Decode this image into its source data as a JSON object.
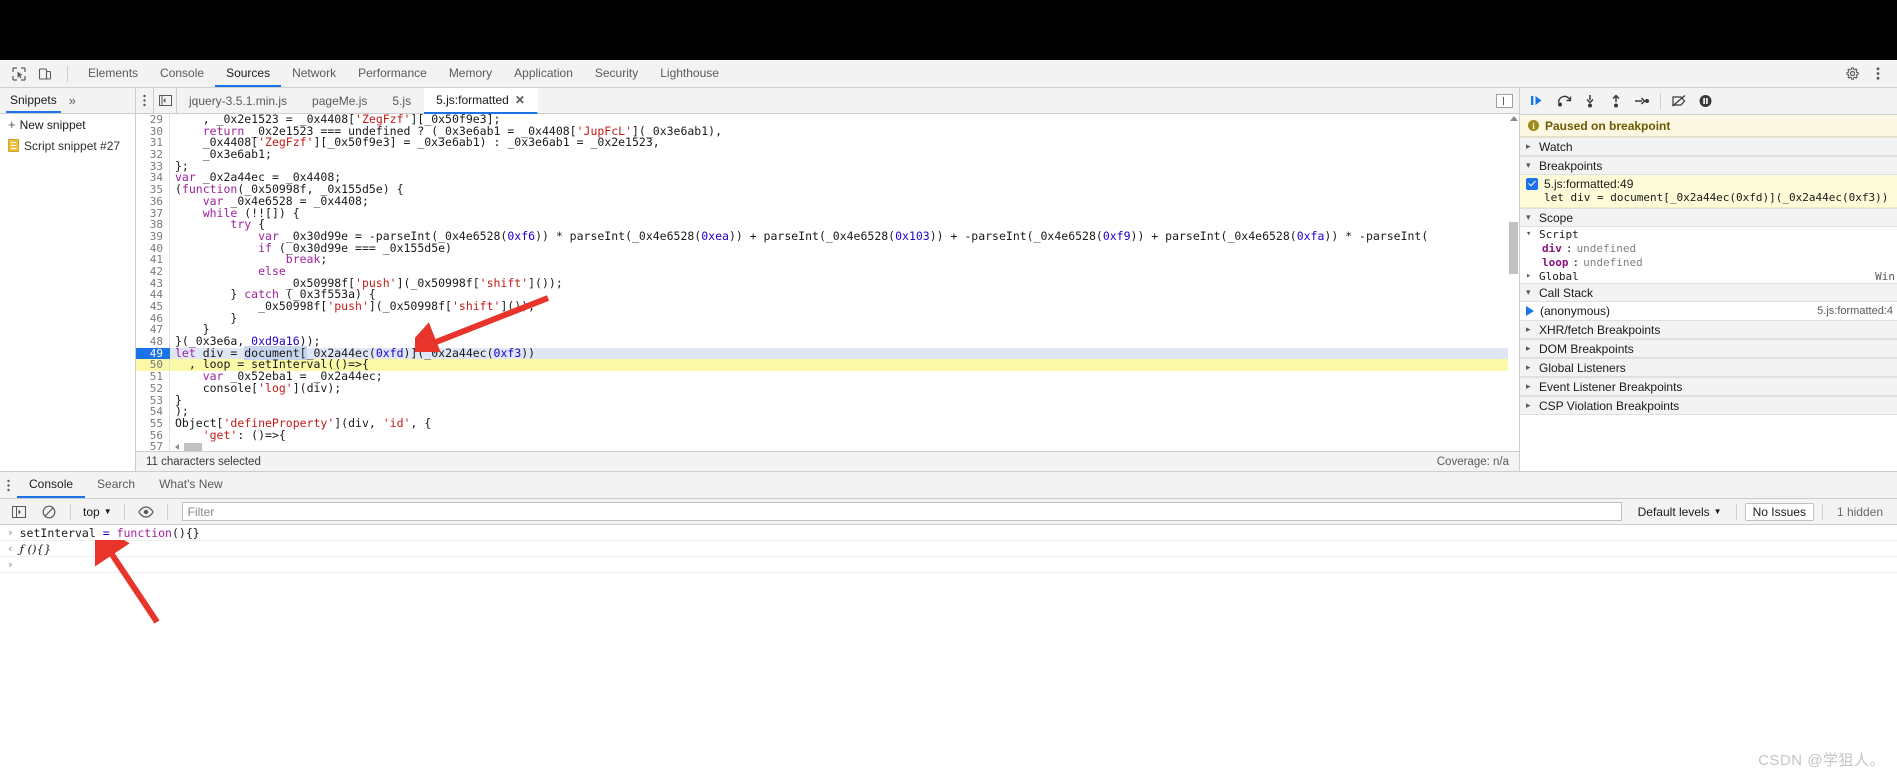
{
  "toolbar": {
    "icons": [
      {
        "name": "inspect-element-icon",
        "label": "Inspect element"
      },
      {
        "name": "device-toolbar-icon",
        "label": "Toggle device toolbar"
      }
    ],
    "tabs": [
      {
        "label": "Elements",
        "active": false
      },
      {
        "label": "Console",
        "active": false
      },
      {
        "label": "Sources",
        "active": true
      },
      {
        "label": "Network",
        "active": false
      },
      {
        "label": "Performance",
        "active": false
      },
      {
        "label": "Memory",
        "active": false
      },
      {
        "label": "Application",
        "active": false
      },
      {
        "label": "Security",
        "active": false
      },
      {
        "label": "Lighthouse",
        "active": false
      }
    ],
    "right_icons": [
      {
        "name": "settings-gear-icon",
        "label": "Settings"
      },
      {
        "name": "more-options-icon",
        "label": "Customize and control DevTools"
      }
    ]
  },
  "navigator": {
    "tab_label": "Snippets",
    "more_label": "»",
    "new_snippet_label": "New snippet",
    "items": [
      {
        "label": "Script snippet #27"
      }
    ]
  },
  "editor": {
    "tabs": [
      {
        "label": "jquery-3.5.1.min.js",
        "active": false,
        "closeable": false
      },
      {
        "label": "pageMe.js",
        "active": false,
        "closeable": false
      },
      {
        "label": "5.js",
        "active": false,
        "closeable": false
      },
      {
        "label": "5.js:formatted",
        "active": true,
        "closeable": true,
        "close_label": "✕"
      }
    ],
    "status": {
      "selection": "11 characters selected",
      "coverage": "Coverage: n/a"
    },
    "first_line_number": 29,
    "lines": [
      {
        "n": 29,
        "tokens": [
          {
            "t": "    , ",
            "c": "t-plain"
          },
          {
            "t": "_0x2e1523 ",
            "c": "t-plain"
          },
          {
            "t": "= ",
            "c": "t-plain"
          },
          {
            "t": "_0x4408[",
            "c": "t-plain"
          },
          {
            "t": "'ZegFzf'",
            "c": "t-str"
          },
          {
            "t": "][_0x50f9e3];",
            "c": "t-plain"
          }
        ],
        "state": "clipped"
      },
      {
        "n": 30,
        "tokens": [
          {
            "t": "    ",
            "c": "t-plain"
          },
          {
            "t": "return ",
            "c": "t-key"
          },
          {
            "t": "_0x2e1523 === ",
            "c": "t-plain"
          },
          {
            "t": "undefined ",
            "c": "t-plain"
          },
          {
            "t": "? (_0x3e6ab1 = _0x4408[",
            "c": "t-plain"
          },
          {
            "t": "'JupFcL'",
            "c": "t-str"
          },
          {
            "t": "](_0x3e6ab1),",
            "c": "t-plain"
          }
        ],
        "state": "normal"
      },
      {
        "n": 31,
        "tokens": [
          {
            "t": "    _0x4408[",
            "c": "t-plain"
          },
          {
            "t": "'ZegFzf'",
            "c": "t-str"
          },
          {
            "t": "][_0x50f9e3] = _0x3e6ab1) : _0x3e6ab1 = _0x2e1523,",
            "c": "t-plain"
          }
        ],
        "state": "normal"
      },
      {
        "n": 32,
        "tokens": [
          {
            "t": "    _0x3e6ab1;",
            "c": "t-plain"
          }
        ],
        "state": "normal"
      },
      {
        "n": 33,
        "tokens": [
          {
            "t": "};",
            "c": "t-plain"
          }
        ],
        "state": "normal"
      },
      {
        "n": 34,
        "tokens": [
          {
            "t": "var ",
            "c": "t-key"
          },
          {
            "t": "_0x2a44ec = _0x4408;",
            "c": "t-plain"
          }
        ],
        "state": "normal"
      },
      {
        "n": 35,
        "tokens": [
          {
            "t": "(",
            "c": "t-plain"
          },
          {
            "t": "function",
            "c": "t-key"
          },
          {
            "t": "(_0x50998f, _0x155d5e) {",
            "c": "t-plain"
          }
        ],
        "state": "normal"
      },
      {
        "n": 36,
        "tokens": [
          {
            "t": "    ",
            "c": "t-plain"
          },
          {
            "t": "var ",
            "c": "t-key"
          },
          {
            "t": "_0x4e6528 = _0x4408;",
            "c": "t-plain"
          }
        ],
        "state": "normal"
      },
      {
        "n": 37,
        "tokens": [
          {
            "t": "    ",
            "c": "t-plain"
          },
          {
            "t": "while ",
            "c": "t-key"
          },
          {
            "t": "(!![]) {",
            "c": "t-plain"
          }
        ],
        "state": "normal"
      },
      {
        "n": 38,
        "tokens": [
          {
            "t": "        ",
            "c": "t-plain"
          },
          {
            "t": "try ",
            "c": "t-key"
          },
          {
            "t": "{",
            "c": "t-plain"
          }
        ],
        "state": "normal"
      },
      {
        "n": 39,
        "tokens": [
          {
            "t": "            ",
            "c": "t-plain"
          },
          {
            "t": "var ",
            "c": "t-key"
          },
          {
            "t": "_0x30d99e = -parseInt(_0x4e6528(",
            "c": "t-plain"
          },
          {
            "t": "0xf6",
            "c": "t-num"
          },
          {
            "t": ")) * parseInt(_0x4e6528(",
            "c": "t-plain"
          },
          {
            "t": "0xea",
            "c": "t-num"
          },
          {
            "t": ")) + parseInt(_0x4e6528(",
            "c": "t-plain"
          },
          {
            "t": "0x103",
            "c": "t-num"
          },
          {
            "t": ")) + -parseInt(_0x4e6528(",
            "c": "t-plain"
          },
          {
            "t": "0xf9",
            "c": "t-num"
          },
          {
            "t": ")) + parseInt(_0x4e6528(",
            "c": "t-plain"
          },
          {
            "t": "0xfa",
            "c": "t-num"
          },
          {
            "t": ")) * -parseInt(",
            "c": "t-plain"
          }
        ],
        "state": "normal"
      },
      {
        "n": 40,
        "tokens": [
          {
            "t": "            ",
            "c": "t-plain"
          },
          {
            "t": "if ",
            "c": "t-key"
          },
          {
            "t": "(_0x30d99e === _0x155d5e)",
            "c": "t-plain"
          }
        ],
        "state": "normal"
      },
      {
        "n": 41,
        "tokens": [
          {
            "t": "                ",
            "c": "t-plain"
          },
          {
            "t": "break",
            "c": "t-key"
          },
          {
            "t": ";",
            "c": "t-plain"
          }
        ],
        "state": "normal"
      },
      {
        "n": 42,
        "tokens": [
          {
            "t": "            ",
            "c": "t-plain"
          },
          {
            "t": "else",
            "c": "t-key"
          }
        ],
        "state": "normal"
      },
      {
        "n": 43,
        "tokens": [
          {
            "t": "                _0x50998f[",
            "c": "t-plain"
          },
          {
            "t": "'push'",
            "c": "t-str"
          },
          {
            "t": "](_0x50998f[",
            "c": "t-plain"
          },
          {
            "t": "'shift'",
            "c": "t-str"
          },
          {
            "t": "]());",
            "c": "t-plain"
          }
        ],
        "state": "normal"
      },
      {
        "n": 44,
        "tokens": [
          {
            "t": "        } ",
            "c": "t-plain"
          },
          {
            "t": "catch ",
            "c": "t-key"
          },
          {
            "t": "(_0x3f553a) {",
            "c": "t-plain"
          }
        ],
        "state": "normal"
      },
      {
        "n": 45,
        "tokens": [
          {
            "t": "            _0x50998f[",
            "c": "t-plain"
          },
          {
            "t": "'push'",
            "c": "t-str"
          },
          {
            "t": "](_0x50998f[",
            "c": "t-plain"
          },
          {
            "t": "'shift'",
            "c": "t-str"
          },
          {
            "t": "]());",
            "c": "t-plain"
          }
        ],
        "state": "normal"
      },
      {
        "n": 46,
        "tokens": [
          {
            "t": "        }",
            "c": "t-plain"
          }
        ],
        "state": "normal"
      },
      {
        "n": 47,
        "tokens": [
          {
            "t": "    }",
            "c": "t-plain"
          }
        ],
        "state": "normal"
      },
      {
        "n": 48,
        "tokens": [
          {
            "t": "}(_0x3e6a, ",
            "c": "t-plain"
          },
          {
            "t": "0xd9a16",
            "c": "t-num"
          },
          {
            "t": "));",
            "c": "t-plain"
          }
        ],
        "state": "normal"
      },
      {
        "n": 49,
        "tokens": [
          {
            "t": "let ",
            "c": "t-key"
          },
          {
            "t": "div = ",
            "c": "t-plain"
          },
          {
            "t": "document[",
            "c": "sel"
          },
          {
            "t": "_0x2a44ec(",
            "c": "t-plain"
          },
          {
            "t": "0xfd",
            "c": "t-num"
          },
          {
            "t": ")](",
            "c": "t-plain"
          },
          {
            "t": "_0x2a44ec(",
            "c": "t-plain"
          },
          {
            "t": "0xf3",
            "c": "t-num"
          },
          {
            "t": "))",
            "c": "t-plain"
          }
        ],
        "state": "exec"
      },
      {
        "n": 50,
        "tokens": [
          {
            "t": "  , loop = ",
            "c": "t-plain"
          },
          {
            "t": "setInterval",
            "c": "t-plain"
          },
          {
            "t": "(()=>{",
            "c": "t-plain"
          }
        ],
        "state": "hl"
      },
      {
        "n": 51,
        "tokens": [
          {
            "t": "    ",
            "c": "t-plain"
          },
          {
            "t": "var ",
            "c": "t-key"
          },
          {
            "t": "_0x52eba1 = _0x2a44ec;",
            "c": "t-plain"
          }
        ],
        "state": "normal"
      },
      {
        "n": 52,
        "tokens": [
          {
            "t": "    console[",
            "c": "t-plain"
          },
          {
            "t": "'log'",
            "c": "t-str"
          },
          {
            "t": "](div);",
            "c": "t-plain"
          }
        ],
        "state": "normal"
      },
      {
        "n": 53,
        "tokens": [
          {
            "t": "}",
            "c": "t-plain"
          }
        ],
        "state": "normal"
      },
      {
        "n": 54,
        "tokens": [
          {
            "t": ");",
            "c": "t-plain"
          }
        ],
        "state": "normal"
      },
      {
        "n": 55,
        "tokens": [
          {
            "t": "Object[",
            "c": "t-plain"
          },
          {
            "t": "'defineProperty'",
            "c": "t-str"
          },
          {
            "t": "](div, ",
            "c": "t-plain"
          },
          {
            "t": "'id'",
            "c": "t-str"
          },
          {
            "t": ", {",
            "c": "t-plain"
          }
        ],
        "state": "normal"
      },
      {
        "n": 56,
        "tokens": [
          {
            "t": "    ",
            "c": "t-plain"
          },
          {
            "t": "'get'",
            "c": "t-str"
          },
          {
            "t": ": ()=>{",
            "c": "t-plain"
          }
        ],
        "state": "normal"
      },
      {
        "n": 57,
        "tokens": [],
        "state": "scrollbar"
      }
    ]
  },
  "debugger": {
    "buttons": [
      {
        "name": "resume-script-button",
        "label": "Resume script execution"
      },
      {
        "name": "step-over-button",
        "label": "Step over next function call"
      },
      {
        "name": "step-into-button",
        "label": "Step into next function call"
      },
      {
        "name": "step-out-button",
        "label": "Step out of current function"
      },
      {
        "name": "step-button",
        "label": "Step"
      },
      {
        "name": "deactivate-breakpoints-button",
        "label": "Deactivate breakpoints"
      },
      {
        "name": "pause-on-exceptions-button",
        "label": "Pause on exceptions"
      }
    ],
    "paused_banner": "Paused on breakpoint",
    "sections": {
      "watch": {
        "label": "Watch",
        "expanded": false
      },
      "breakpoints": {
        "label": "Breakpoints",
        "expanded": true,
        "items": [
          {
            "location": "5.js:formatted:49",
            "code": "let div = document[_0x2a44ec(0xfd)](_0x2a44ec(0xf3))",
            "checked": true
          }
        ]
      },
      "scope": {
        "label": "Scope",
        "expanded": true,
        "groups": [
          {
            "label": "Script",
            "expanded": true,
            "vars": [
              {
                "name": "div",
                "value": "undefined"
              },
              {
                "name": "loop",
                "value": "undefined"
              }
            ]
          },
          {
            "label": "Global",
            "expanded": false,
            "value": "Win"
          }
        ]
      },
      "call_stack": {
        "label": "Call Stack",
        "expanded": true,
        "frames": [
          {
            "name": "(anonymous)",
            "location": "5.js:formatted:4"
          }
        ]
      },
      "xhr_breakpoints": {
        "label": "XHR/fetch Breakpoints",
        "expanded": false
      },
      "dom_breakpoints": {
        "label": "DOM Breakpoints",
        "expanded": false
      },
      "global_listeners": {
        "label": "Global Listeners",
        "expanded": false
      },
      "event_listener_breakpoints": {
        "label": "Event Listener Breakpoints",
        "expanded": false
      },
      "csp_violation_breakpoints": {
        "label": "CSP Violation Breakpoints",
        "expanded": false
      }
    }
  },
  "drawer": {
    "tabs": [
      {
        "label": "Console",
        "active": true
      },
      {
        "label": "Search",
        "active": false
      },
      {
        "label": "What's New",
        "active": false
      }
    ],
    "console_toolbar": {
      "sidebar_toggle": "console-sidebar-icon",
      "clear_label": "clear-console-icon",
      "context": "top",
      "context_caret": "▼",
      "eye_icon": "live-expression-icon",
      "filter_placeholder": "Filter",
      "filter_value": "",
      "levels_label": "Default levels",
      "levels_caret": "▼",
      "issues_label": "No Issues",
      "hidden_label": "1 hidden"
    },
    "messages": [
      {
        "kind": "input",
        "marker": "›",
        "tokens": [
          {
            "t": "setInterval ",
            "c": "c-id"
          },
          {
            "t": "= ",
            "c": "c-blue"
          },
          {
            "t": "function",
            "c": "c-kw"
          },
          {
            "t": "(){}",
            "c": "c-punc"
          }
        ]
      },
      {
        "kind": "output",
        "marker": "‹",
        "tokens": [
          {
            "t": "ƒ (){}",
            "c": "c-fn"
          }
        ]
      },
      {
        "kind": "prompt",
        "marker": "›",
        "tokens": []
      }
    ]
  },
  "watermark": "CSDN @学狙人。",
  "colors": {
    "accent": "#1a73e8",
    "exec_line": "#dfe7f7",
    "highlight_line": "#fbf9a8",
    "breakpoint_bg": "#fdfbd8",
    "paused_banner_bg": "#fdf8e3",
    "arrow_red": "#e8342a"
  }
}
